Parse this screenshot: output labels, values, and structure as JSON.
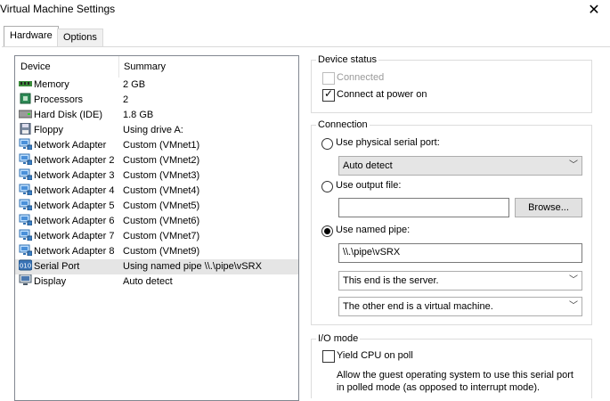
{
  "window": {
    "title": "Virtual Machine Settings"
  },
  "tabs": [
    {
      "label": "Hardware"
    },
    {
      "label": "Options"
    }
  ],
  "device_list": {
    "headers": {
      "device": "Device",
      "summary": "Summary"
    },
    "rows": [
      {
        "device": "Memory",
        "summary": "2 GB",
        "icon": "memory-icon"
      },
      {
        "device": "Processors",
        "summary": "2",
        "icon": "processor-icon"
      },
      {
        "device": "Hard Disk (IDE)",
        "summary": "1.8 GB",
        "icon": "hard-disk-icon"
      },
      {
        "device": "Floppy",
        "summary": "Using drive A:",
        "icon": "floppy-icon"
      },
      {
        "device": "Network Adapter",
        "summary": "Custom (VMnet1)",
        "icon": "network-adapter-icon"
      },
      {
        "device": "Network Adapter 2",
        "summary": "Custom (VMnet2)",
        "icon": "network-adapter-icon"
      },
      {
        "device": "Network Adapter 3",
        "summary": "Custom (VMnet3)",
        "icon": "network-adapter-icon"
      },
      {
        "device": "Network Adapter 4",
        "summary": "Custom (VMnet4)",
        "icon": "network-adapter-icon"
      },
      {
        "device": "Network Adapter 5",
        "summary": "Custom (VMnet5)",
        "icon": "network-adapter-icon"
      },
      {
        "device": "Network Adapter 6",
        "summary": "Custom (VMnet6)",
        "icon": "network-adapter-icon"
      },
      {
        "device": "Network Adapter 7",
        "summary": "Custom (VMnet7)",
        "icon": "network-adapter-icon"
      },
      {
        "device": "Network Adapter 8",
        "summary": "Custom (VMnet9)",
        "icon": "network-adapter-icon"
      },
      {
        "device": "Serial Port",
        "summary": "Using named pipe \\\\.\\pipe\\vSRX",
        "icon": "serial-port-icon",
        "selected": true
      },
      {
        "device": "Display",
        "summary": "Auto detect",
        "icon": "display-icon"
      }
    ]
  },
  "device_status": {
    "title": "Device status",
    "connected_label": "Connected",
    "connected_checked": false,
    "connect_power_label": "Connect at power on",
    "connect_power_checked": true
  },
  "connection": {
    "title": "Connection",
    "physical_label": "Use physical serial port:",
    "physical_select": "Auto detect",
    "output_file_label": "Use output file:",
    "output_file_value": "",
    "browse_label": "Browse...",
    "named_pipe_label": "Use named pipe:",
    "named_pipe_value": "\\\\.\\pipe\\vSRX",
    "end_select": "This end is the server.",
    "other_end_select": "The other end is a virtual machine.",
    "selected": "named_pipe"
  },
  "io_mode": {
    "title": "I/O mode",
    "yield_label": "Yield CPU on poll",
    "yield_checked": false,
    "description": "Allow the guest operating system to use this serial port in polled mode (as opposed to interrupt mode)."
  },
  "colors": {
    "selection": "#e5e5e5",
    "border": "#828790",
    "disabled_text": "#9a9a9a"
  }
}
